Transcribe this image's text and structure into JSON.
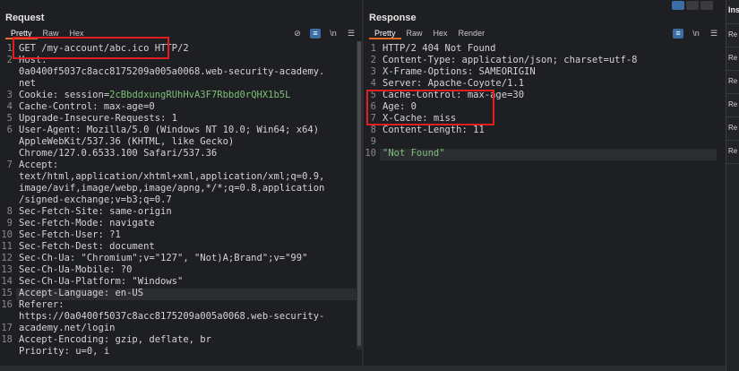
{
  "request": {
    "title": "Request",
    "tabs": [
      "Pretty",
      "Raw",
      "Hex"
    ],
    "line_numbers": [
      "1",
      "2",
      "",
      "",
      "3",
      "4",
      "5",
      "6",
      "",
      "",
      "7",
      "",
      "",
      "",
      "8",
      "9",
      "10",
      "11",
      "12",
      "13",
      "14",
      "15",
      "16",
      "",
      "17",
      "18"
    ],
    "lines": [
      {
        "parts": [
          [
            "GET /my-account/abc.ico HTTP/2",
            "key"
          ]
        ]
      },
      {
        "parts": [
          [
            "Host:",
            "key"
          ]
        ]
      },
      {
        "parts": [
          [
            "0a0400f5037c8acc8175209a005a0068.web-security-academy.",
            "key"
          ]
        ]
      },
      {
        "parts": [
          [
            "net",
            "key"
          ]
        ]
      },
      {
        "parts": [
          [
            "Cookie: session=",
            "key"
          ],
          [
            "2cBbddxungRUhHvA3F7Rbbd0rQHX1b5L",
            "green"
          ]
        ]
      },
      {
        "parts": [
          [
            "Cache-Control: max-age=0",
            "key"
          ]
        ]
      },
      {
        "parts": [
          [
            "Upgrade-Insecure-Requests: 1",
            "key"
          ]
        ]
      },
      {
        "parts": [
          [
            "User-Agent: Mozilla/5.0 (Windows NT 10.0; Win64; x64)",
            "key"
          ]
        ]
      },
      {
        "parts": [
          [
            "AppleWebKit/537.36 (KHTML, like Gecko)",
            "key"
          ]
        ]
      },
      {
        "parts": [
          [
            "Chrome/127.0.6533.100 Safari/537.36",
            "key"
          ]
        ]
      },
      {
        "parts": [
          [
            "Accept:",
            "key"
          ]
        ]
      },
      {
        "parts": [
          [
            "text/html,application/xhtml+xml,application/xml;q=0.9,",
            "key"
          ]
        ]
      },
      {
        "parts": [
          [
            "image/avif,image/webp,image/apng,*/*;q=0.8,application",
            "key"
          ]
        ]
      },
      {
        "parts": [
          [
            "/signed-exchange;v=b3;q=0.7",
            "key"
          ]
        ]
      },
      {
        "parts": [
          [
            "Sec-Fetch-Site: same-origin",
            "key"
          ]
        ]
      },
      {
        "parts": [
          [
            "Sec-Fetch-Mode: navigate",
            "key"
          ]
        ]
      },
      {
        "parts": [
          [
            "Sec-Fetch-User: ?1",
            "key"
          ]
        ]
      },
      {
        "parts": [
          [
            "Sec-Fetch-Dest: document",
            "key"
          ]
        ]
      },
      {
        "parts": [
          [
            "Sec-Ch-Ua: \"Chromium\";v=\"127\", \"Not)A;Brand\";v=\"99\"",
            "key"
          ]
        ]
      },
      {
        "parts": [
          [
            "Sec-Ch-Ua-Mobile: ?0",
            "key"
          ]
        ]
      },
      {
        "parts": [
          [
            "Sec-Ch-Ua-Platform: \"Windows\"",
            "key"
          ]
        ]
      },
      {
        "parts": [
          [
            "Accept-Language: en-US",
            "key"
          ]
        ]
      },
      {
        "parts": [
          [
            "Referer:",
            "key"
          ]
        ]
      },
      {
        "parts": [
          [
            "https://0a0400f5037c8acc8175209a005a0068.web-security-",
            "key"
          ]
        ]
      },
      {
        "parts": [
          [
            "academy.net/login",
            "key"
          ]
        ]
      },
      {
        "parts": [
          [
            "Accept-Encoding: gzip, deflate, br",
            "key"
          ]
        ]
      },
      {
        "parts": [
          [
            "Priority: u=0, i",
            "key"
          ]
        ]
      }
    ]
  },
  "response": {
    "title": "Response",
    "tabs": [
      "Pretty",
      "Raw",
      "Hex",
      "Render"
    ],
    "line_numbers": [
      "1",
      "2",
      "3",
      "4",
      "5",
      "6",
      "7",
      "8",
      "9",
      "10"
    ],
    "lines": [
      {
        "parts": [
          [
            "HTTP/2 404 Not Found",
            "key"
          ]
        ]
      },
      {
        "parts": [
          [
            "Content-Type: application/json; charset=utf-8",
            "key"
          ]
        ]
      },
      {
        "parts": [
          [
            "X-Frame-Options: SAMEORIGIN",
            "key"
          ]
        ]
      },
      {
        "parts": [
          [
            "Server: Apache-Coyote/1.1",
            "key"
          ]
        ]
      },
      {
        "parts": [
          [
            "Cache-Control: max-age=30",
            "key"
          ]
        ]
      },
      {
        "parts": [
          [
            "Age: 0",
            "key"
          ]
        ]
      },
      {
        "parts": [
          [
            "X-Cache: miss",
            "key"
          ]
        ]
      },
      {
        "parts": [
          [
            "Content-Length: 11",
            "key"
          ]
        ]
      },
      {
        "parts": [
          [
            "",
            "key"
          ]
        ]
      },
      {
        "parts": [
          [
            "\"Not Found\"",
            "green"
          ]
        ]
      }
    ]
  },
  "inspector": {
    "title": "Ins",
    "rows": [
      "Re",
      "Re",
      "Re",
      "Re",
      "Re",
      "Re"
    ]
  },
  "toolbar_icons": {
    "request": [
      "eye-off-icon",
      "wrap-icon",
      "newline-icon",
      "menu-icon"
    ],
    "response": [
      "wrap-icon",
      "newline-icon",
      "menu-icon"
    ]
  },
  "colors": {
    "highlight_box": "#e02020",
    "active_tab_underline": "#e46a2c",
    "toggle_active": "#3b6ea5",
    "value_green": "#7ec07a"
  }
}
